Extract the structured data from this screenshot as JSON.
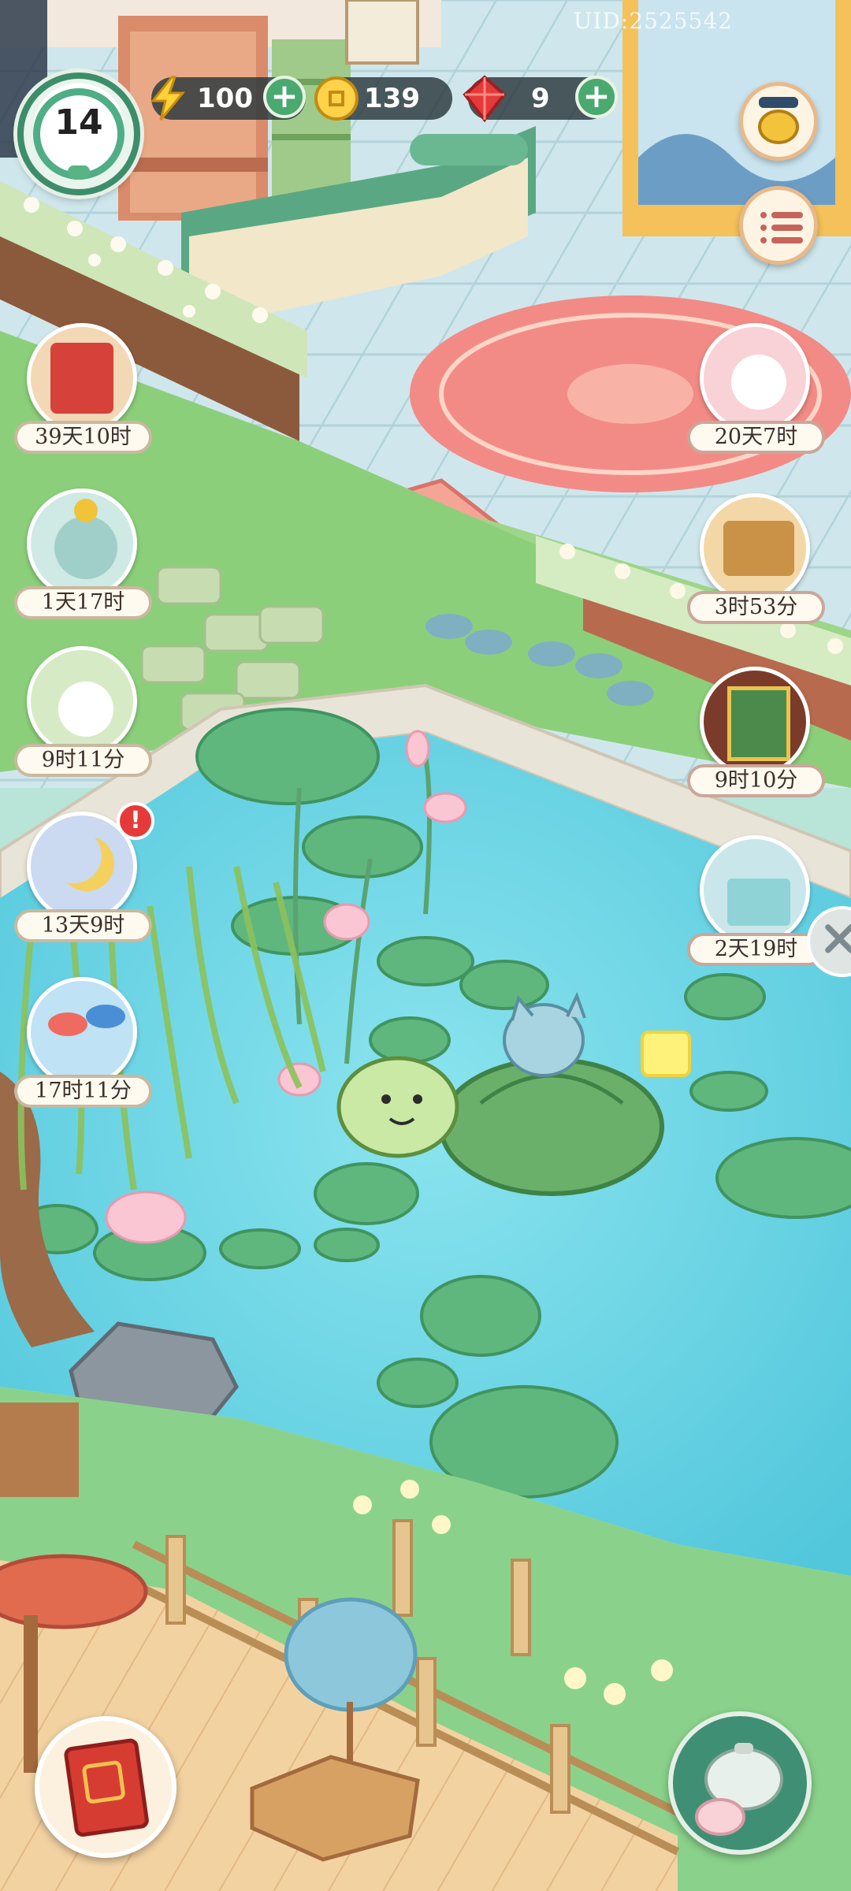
{
  "hud": {
    "uid": "UID:2525542",
    "level": "14",
    "energy": "100",
    "coins": "139",
    "gems": "9"
  },
  "events_left": [
    {
      "name": "scroll-bundle",
      "timer": "39天10时"
    },
    {
      "name": "lucky-cat",
      "timer": "1天17时"
    },
    {
      "name": "bird-bamboo",
      "timer": "9时11分"
    },
    {
      "name": "moon-rabbit",
      "timer": "13天9时",
      "alert": "!"
    },
    {
      "name": "koi-fish",
      "timer": "17时11分"
    }
  ],
  "events_right": [
    {
      "name": "rabbit-blossom",
      "timer": "20天7时"
    },
    {
      "name": "tea-box",
      "timer": "3时53分"
    },
    {
      "name": "plus-one-gate",
      "timer": "9时10分"
    },
    {
      "name": "cat-gift-box",
      "timer": "2天19时"
    }
  ],
  "colors": {
    "water": "#6fd6e6",
    "grass": "#8ccf7a",
    "hud_pill": "#28373c",
    "plus_green": "#4aa96f",
    "timer_text": "#3b2f2a"
  },
  "icons": {
    "energy": "lightning-icon",
    "coins": "coin-icon",
    "gems": "red-gem-icon",
    "menu": "list-menu-icon",
    "shop": "golden-teapot-icon",
    "book": "red-book-icon",
    "tea": "teapot-rabbit-icon"
  }
}
